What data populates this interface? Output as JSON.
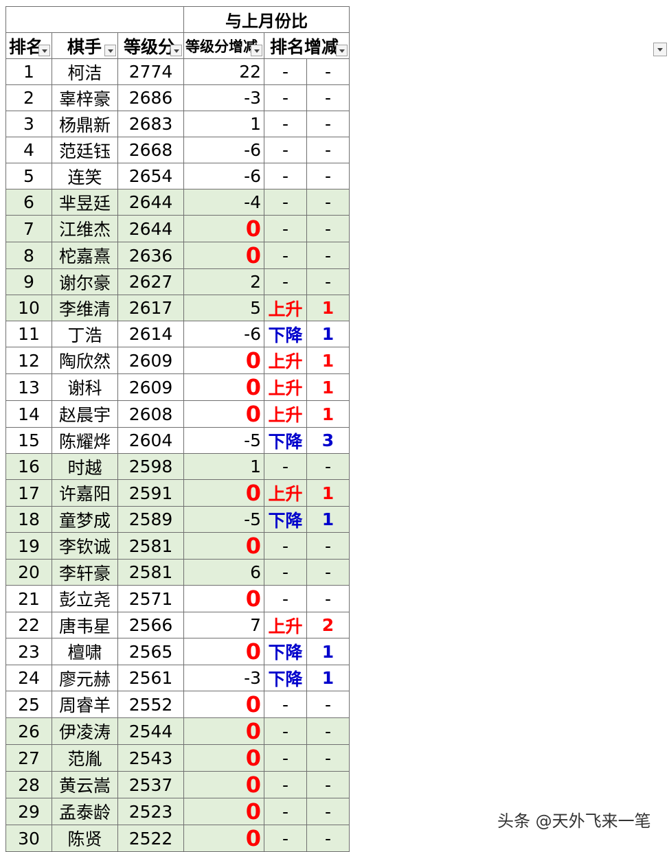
{
  "header": {
    "group_title": "与上月份比",
    "columns": [
      "排名",
      "棋手",
      "等级分",
      "等级分增减",
      "排名增减"
    ]
  },
  "rows": [
    {
      "rank": "1",
      "name": "柯洁",
      "score": "2774",
      "change": "22",
      "dir": "-",
      "rank_change": "-",
      "shade": false
    },
    {
      "rank": "2",
      "name": "辜梓豪",
      "score": "2686",
      "change": "-3",
      "dir": "-",
      "rank_change": "-",
      "shade": false
    },
    {
      "rank": "3",
      "name": "杨鼎新",
      "score": "2683",
      "change": "1",
      "dir": "-",
      "rank_change": "-",
      "shade": false
    },
    {
      "rank": "4",
      "name": "范廷钰",
      "score": "2668",
      "change": "-6",
      "dir": "-",
      "rank_change": "-",
      "shade": false
    },
    {
      "rank": "5",
      "name": "连笑",
      "score": "2654",
      "change": "-6",
      "dir": "-",
      "rank_change": "-",
      "shade": false
    },
    {
      "rank": "6",
      "name": "芈昱廷",
      "score": "2644",
      "change": "-4",
      "dir": "-",
      "rank_change": "-",
      "shade": true
    },
    {
      "rank": "7",
      "name": "江维杰",
      "score": "2644",
      "change": "0",
      "dir": "-",
      "rank_change": "-",
      "shade": true
    },
    {
      "rank": "8",
      "name": "柁嘉熹",
      "score": "2636",
      "change": "0",
      "dir": "-",
      "rank_change": "-",
      "shade": true
    },
    {
      "rank": "9",
      "name": "谢尔豪",
      "score": "2627",
      "change": "2",
      "dir": "-",
      "rank_change": "-",
      "shade": true
    },
    {
      "rank": "10",
      "name": "李维清",
      "score": "2617",
      "change": "5",
      "dir": "上升",
      "rank_change": "1",
      "shade": true
    },
    {
      "rank": "11",
      "name": "丁浩",
      "score": "2614",
      "change": "-6",
      "dir": "下降",
      "rank_change": "1",
      "shade": false
    },
    {
      "rank": "12",
      "name": "陶欣然",
      "score": "2609",
      "change": "0",
      "dir": "上升",
      "rank_change": "1",
      "shade": false
    },
    {
      "rank": "13",
      "name": "谢科",
      "score": "2609",
      "change": "0",
      "dir": "上升",
      "rank_change": "1",
      "shade": false
    },
    {
      "rank": "14",
      "name": "赵晨宇",
      "score": "2608",
      "change": "0",
      "dir": "上升",
      "rank_change": "1",
      "shade": false
    },
    {
      "rank": "15",
      "name": "陈耀烨",
      "score": "2604",
      "change": "-5",
      "dir": "下降",
      "rank_change": "3",
      "shade": false
    },
    {
      "rank": "16",
      "name": "时越",
      "score": "2598",
      "change": "1",
      "dir": "-",
      "rank_change": "-",
      "shade": true
    },
    {
      "rank": "17",
      "name": "许嘉阳",
      "score": "2591",
      "change": "0",
      "dir": "上升",
      "rank_change": "1",
      "shade": true
    },
    {
      "rank": "18",
      "name": "童梦成",
      "score": "2589",
      "change": "-5",
      "dir": "下降",
      "rank_change": "1",
      "shade": true
    },
    {
      "rank": "19",
      "name": "李钦诚",
      "score": "2581",
      "change": "0",
      "dir": "-",
      "rank_change": "-",
      "shade": true
    },
    {
      "rank": "20",
      "name": "李轩豪",
      "score": "2581",
      "change": "6",
      "dir": "-",
      "rank_change": "-",
      "shade": true
    },
    {
      "rank": "21",
      "name": "彭立尧",
      "score": "2571",
      "change": "0",
      "dir": "-",
      "rank_change": "-",
      "shade": false
    },
    {
      "rank": "22",
      "name": "唐韦星",
      "score": "2566",
      "change": "7",
      "dir": "上升",
      "rank_change": "2",
      "shade": false
    },
    {
      "rank": "23",
      "name": "檀啸",
      "score": "2565",
      "change": "0",
      "dir": "下降",
      "rank_change": "1",
      "shade": false
    },
    {
      "rank": "24",
      "name": "廖元赫",
      "score": "2561",
      "change": "-3",
      "dir": "下降",
      "rank_change": "1",
      "shade": false
    },
    {
      "rank": "25",
      "name": "周睿羊",
      "score": "2552",
      "change": "0",
      "dir": "-",
      "rank_change": "-",
      "shade": false
    },
    {
      "rank": "26",
      "name": "伊凌涛",
      "score": "2544",
      "change": "0",
      "dir": "-",
      "rank_change": "-",
      "shade": true
    },
    {
      "rank": "27",
      "name": "范胤",
      "score": "2543",
      "change": "0",
      "dir": "-",
      "rank_change": "-",
      "shade": true
    },
    {
      "rank": "28",
      "name": "黄云嵩",
      "score": "2537",
      "change": "0",
      "dir": "-",
      "rank_change": "-",
      "shade": true
    },
    {
      "rank": "29",
      "name": "孟泰龄",
      "score": "2523",
      "change": "0",
      "dir": "-",
      "rank_change": "-",
      "shade": true
    },
    {
      "rank": "30",
      "name": "陈贤",
      "score": "2522",
      "change": "0",
      "dir": "-",
      "rank_change": "-",
      "shade": true
    }
  ],
  "colors": {
    "shade": "#e2efda",
    "up": "#ff0000",
    "down": "#0000cc",
    "zero": "#ff0000"
  },
  "watermark": "头条 @天外飞来一笔"
}
